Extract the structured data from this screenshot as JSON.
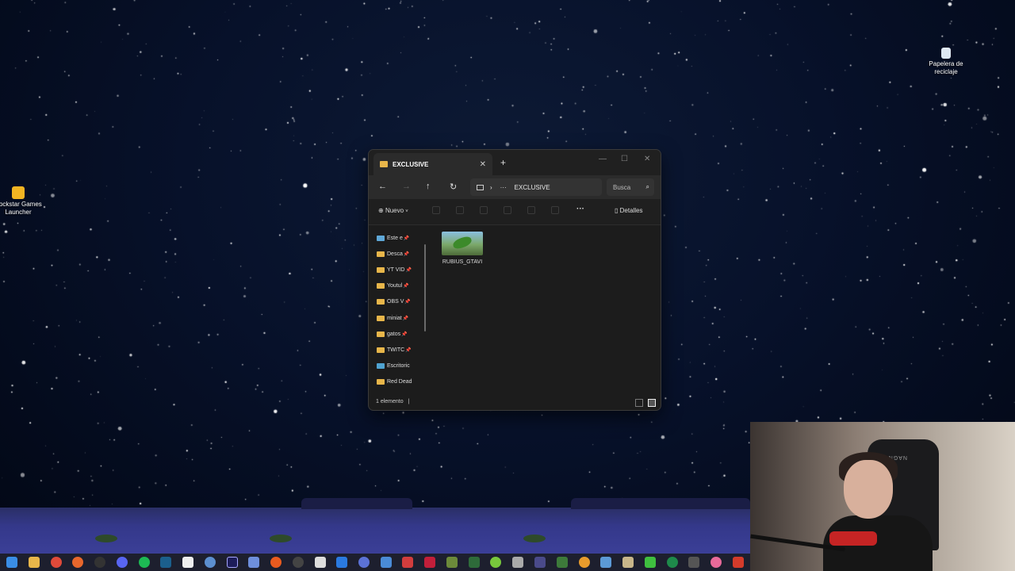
{
  "desktop": {
    "icons": [
      {
        "label": "Rockstar Games Launcher",
        "icon": "rockstar-icon"
      },
      {
        "label": "Papelera de reciclaje",
        "icon": "recycle-bin-icon"
      }
    ]
  },
  "explorer": {
    "tab_title": "EXCLUSIVE",
    "breadcrumb_ellipsis": "···",
    "breadcrumb_current": "EXCLUSIVE",
    "search_placeholder": "Busca",
    "new_label": "Nuevo",
    "details_label": "Detalles",
    "more_label": "···",
    "sidebar": [
      {
        "label": "Este e",
        "pinned": true,
        "icon": "pc-folder-icon"
      },
      {
        "label": "Desca",
        "pinned": true,
        "icon": "folder-icon"
      },
      {
        "label": "YT VID",
        "pinned": true,
        "icon": "folder-icon"
      },
      {
        "label": "Youtul",
        "pinned": true,
        "icon": "folder-icon"
      },
      {
        "label": "OBS V",
        "pinned": true,
        "icon": "folder-icon"
      },
      {
        "label": "miniat",
        "pinned": true,
        "icon": "folder-icon"
      },
      {
        "label": "gatos",
        "pinned": true,
        "icon": "folder-icon"
      },
      {
        "label": "TWITC",
        "pinned": true,
        "icon": "folder-icon"
      },
      {
        "label": "Escritoric",
        "pinned": false,
        "icon": "desktop-folder-icon"
      },
      {
        "label": "Red Dead",
        "pinned": false,
        "icon": "folder-icon"
      }
    ],
    "files": [
      {
        "name": "RUBIUS_GTAVI",
        "icon": "image-thumbnail"
      }
    ],
    "status": "1 elemento",
    "status_sep": "|"
  },
  "webcam": {
    "chair_text": "NAGNUS"
  },
  "colors": {
    "folder": "#e8b64a",
    "explorer_bg": "#1c1c1c",
    "accent_red": "#c52424"
  }
}
